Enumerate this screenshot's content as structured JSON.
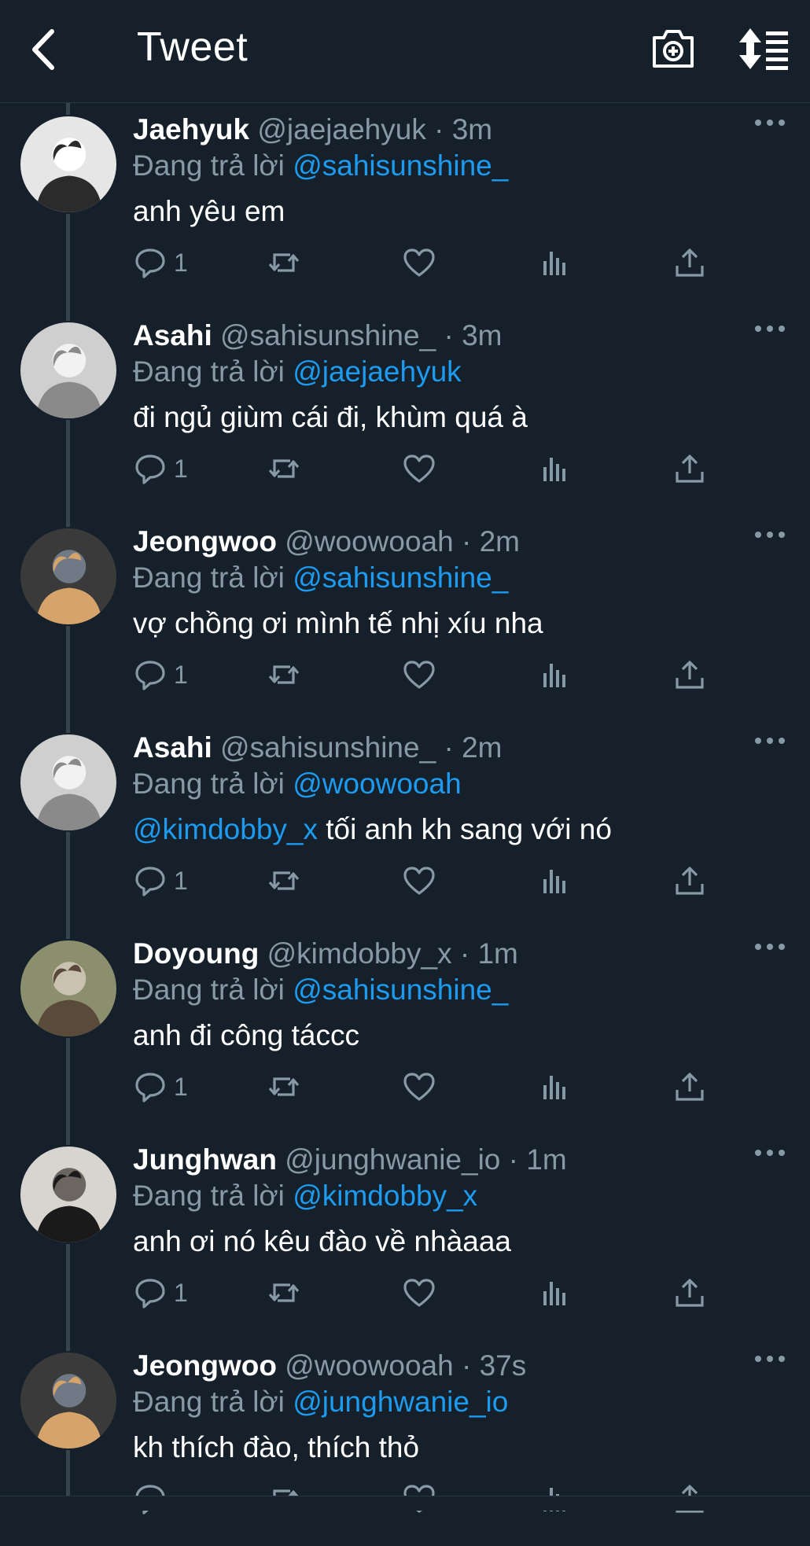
{
  "header": {
    "title": "Tweet",
    "icons": {
      "back": "chevron-left-icon",
      "camera": "camera-plus-icon",
      "sort": "sort-list-icon"
    }
  },
  "colors": {
    "background": "#15202b",
    "mention": "#1d9bf0",
    "muted": "#8899a6",
    "thread_line": "#38444d"
  },
  "reply_prefix": "Đang trả lời",
  "tweets": [
    {
      "name": "Jaehyuk",
      "handle": "@jaejaehyuk",
      "dot": "·",
      "time": "3m",
      "reply_to": "@sahisunshine_",
      "mention_in_text": "",
      "text": "anh yêu em",
      "reply_count": "1",
      "avatar": "photo-avatar"
    },
    {
      "name": "Asahi",
      "handle": "@sahisunshine_",
      "dot": "·",
      "time": "3m",
      "reply_to": "@jaejaehyuk",
      "mention_in_text": "",
      "text": "đi ngủ giùm cái đi, khùm quá à",
      "reply_count": "1",
      "avatar": "photo-avatar"
    },
    {
      "name": "Jeongwoo",
      "handle": "@woowooah",
      "dot": "·",
      "time": "2m",
      "reply_to": "@sahisunshine_",
      "mention_in_text": "",
      "text": "vợ chồng ơi mình tế nhị xíu nha",
      "reply_count": "1",
      "avatar": "photo-avatar"
    },
    {
      "name": "Asahi",
      "handle": "@sahisunshine_",
      "dot": "·",
      "time": "2m",
      "reply_to": "@woowooah",
      "mention_in_text": "@kimdobby_x",
      "text": " tối anh kh sang với nó",
      "reply_count": "1",
      "avatar": "photo-avatar"
    },
    {
      "name": "Doyoung",
      "handle": "@kimdobby_x",
      "dot": "·",
      "time": "1m",
      "reply_to": "@sahisunshine_",
      "mention_in_text": "",
      "text": "anh đi công táccc",
      "reply_count": "1",
      "avatar": "photo-avatar"
    },
    {
      "name": "Junghwan",
      "handle": "@junghwanie_io",
      "dot": "·",
      "time": "1m",
      "reply_to": "@kimdobby_x",
      "mention_in_text": "",
      "text": "anh ơi nó kêu đào về nhàaaa",
      "reply_count": "1",
      "avatar": "photo-avatar"
    },
    {
      "name": "Jeongwoo",
      "handle": "@woowooah",
      "dot": "·",
      "time": "37s",
      "reply_to": "@junghwanie_io",
      "mention_in_text": "",
      "text": "kh thích đào, thích thỏ",
      "reply_count": "",
      "avatar": "photo-avatar"
    }
  ]
}
